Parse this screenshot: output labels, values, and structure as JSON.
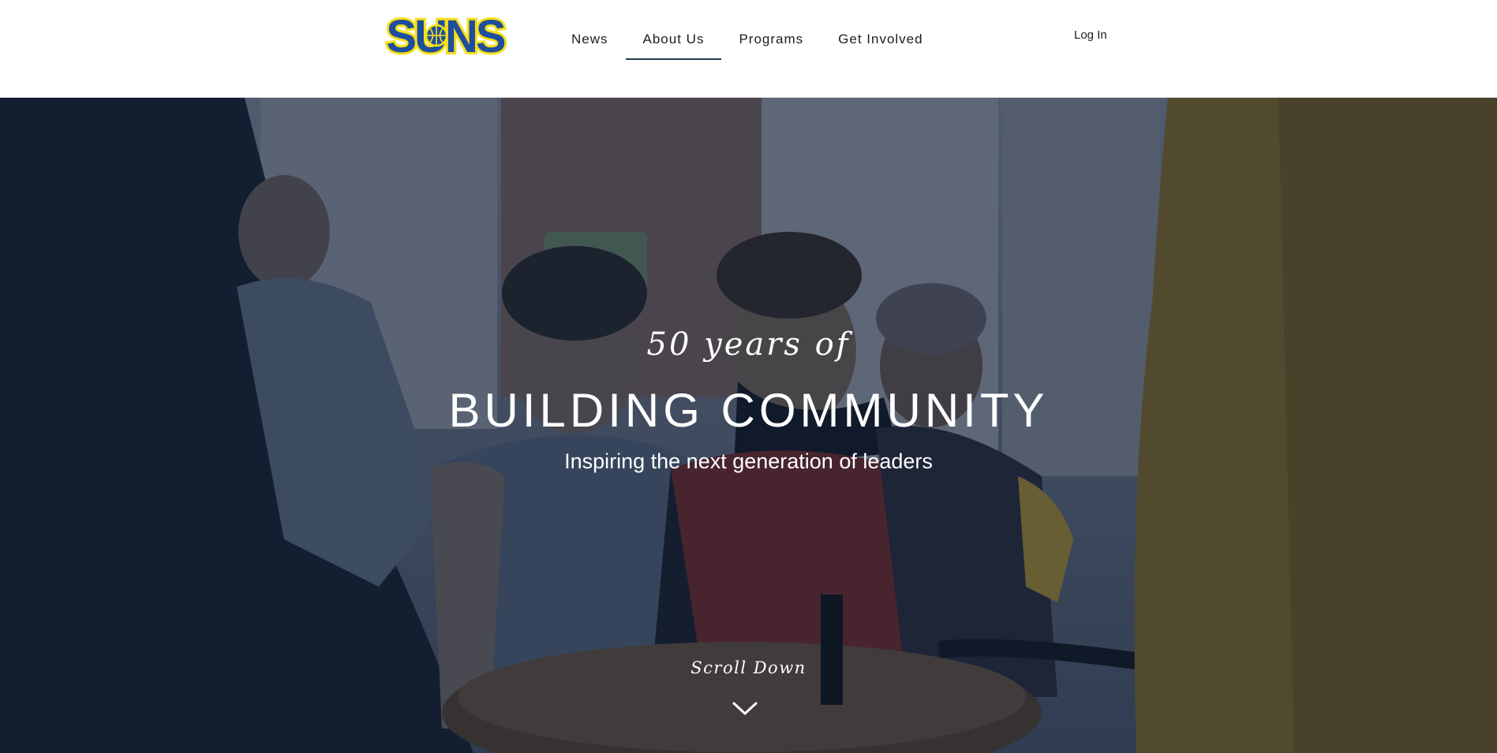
{
  "header": {
    "logo_text": "SUNS",
    "nav": [
      {
        "label": "News",
        "active": false
      },
      {
        "label": "About Us",
        "active": true
      },
      {
        "label": "Programs",
        "active": false
      },
      {
        "label": "Get Involved",
        "active": false
      }
    ],
    "login_label": "Log In"
  },
  "hero": {
    "tagline": "50 years of",
    "title": "BUILDING COMMUNITY",
    "subtitle": "Inspiring the next generation of leaders",
    "scroll_label": "Scroll Down"
  },
  "colors": {
    "logo_blue": "#1f4e9c",
    "logo_yellow": "#f5e01a",
    "nav_underline": "#1d3a4c",
    "text_dark": "#1d1d1d",
    "hero_overlay": "#0c182c"
  },
  "icons": [
    "basketball-icon",
    "chevron-down-icon"
  ]
}
